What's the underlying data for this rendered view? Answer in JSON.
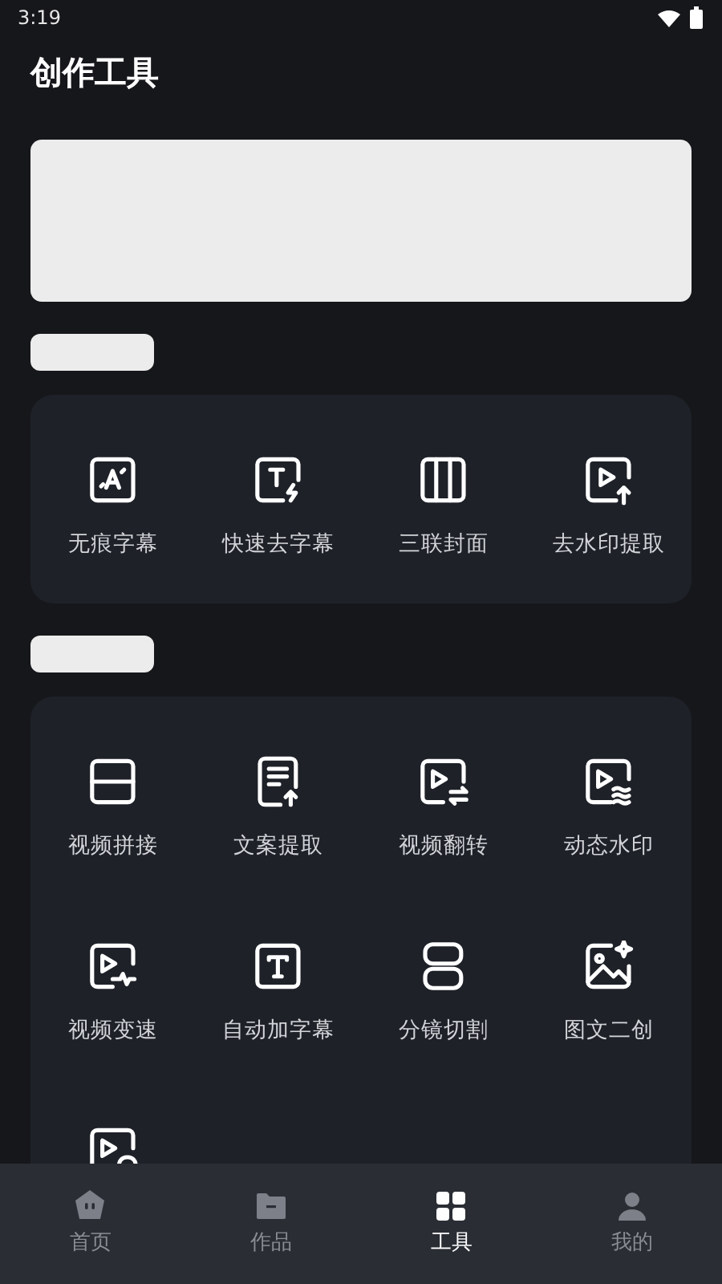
{
  "status_bar": {
    "time": "3:19"
  },
  "title": "创作工具",
  "sections": [
    {
      "tools": [
        {
          "kind": "erase",
          "label": "无痕字幕"
        },
        {
          "kind": "quick",
          "label": "快速去字幕"
        },
        {
          "kind": "triptych",
          "label": "三联封面"
        },
        {
          "kind": "extract",
          "label": "去水印提取"
        }
      ]
    },
    {
      "tools": [
        {
          "kind": "join",
          "label": "视频拼接"
        },
        {
          "kind": "copy",
          "label": "文案提取"
        },
        {
          "kind": "flip",
          "label": "视频翻转"
        },
        {
          "kind": "watermark",
          "label": "动态水印"
        },
        {
          "kind": "speed",
          "label": "视频变速"
        },
        {
          "kind": "caption",
          "label": "自动加字幕"
        },
        {
          "kind": "storyboard",
          "label": "分镜切割"
        },
        {
          "kind": "remix",
          "label": "图文二创"
        },
        {
          "kind": "record"
        }
      ]
    }
  ],
  "nav": [
    {
      "kind": "home",
      "label": "首页",
      "selected": false
    },
    {
      "kind": "works",
      "label": "作品",
      "selected": false
    },
    {
      "kind": "tools",
      "label": "工具",
      "selected": true
    },
    {
      "kind": "mine",
      "label": "我的",
      "selected": false
    }
  ]
}
